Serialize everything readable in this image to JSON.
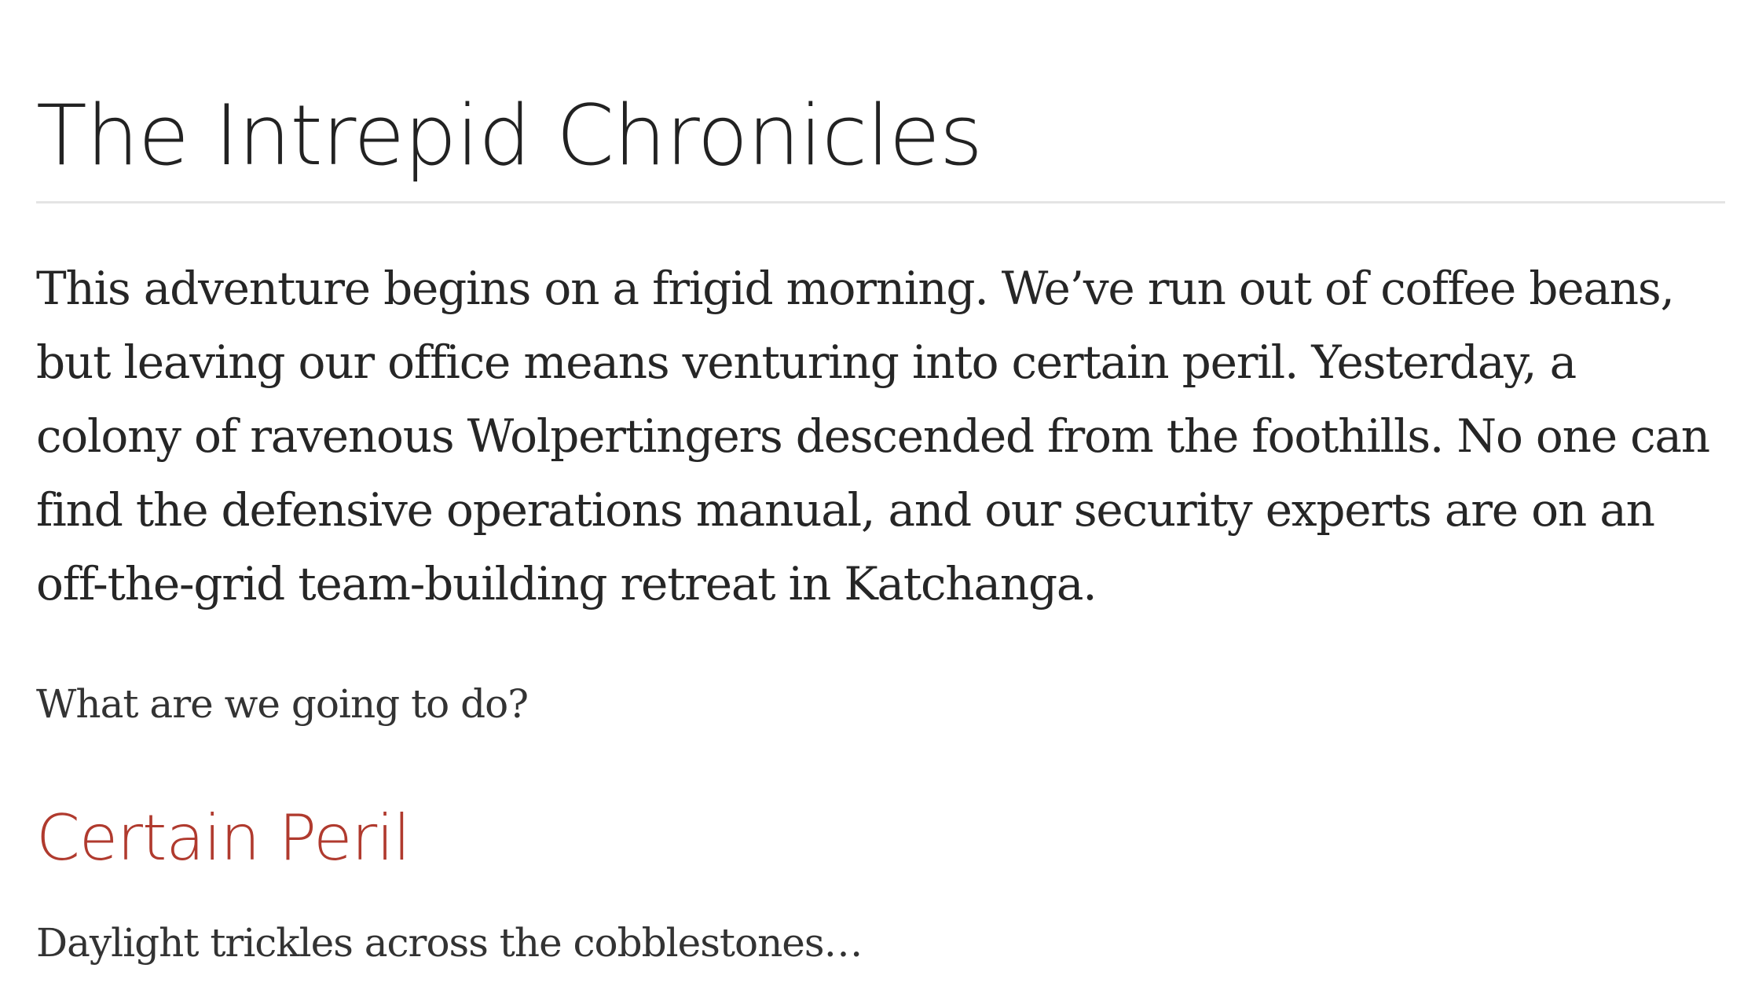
{
  "article": {
    "title": "The Intrepid Chronicles",
    "intro": "This adventure begins on a frigid morning. We’ve run out of coffee beans, but leaving our office means venturing into certain peril. Yesterday, a colony of ravenous Wolpertingers descended from the foothills. No one can find the defensive operations manual, and our security experts are on an off-the-grid team-building retreat in Katchanga.",
    "question": "What are we going to do?",
    "section": {
      "heading": "Certain Peril",
      "teaser": "Daylight trickles across the cobblestones…"
    }
  },
  "colors": {
    "text": "#262626",
    "heading_accent": "#b03a2e",
    "divider": "#e4e4e4"
  }
}
